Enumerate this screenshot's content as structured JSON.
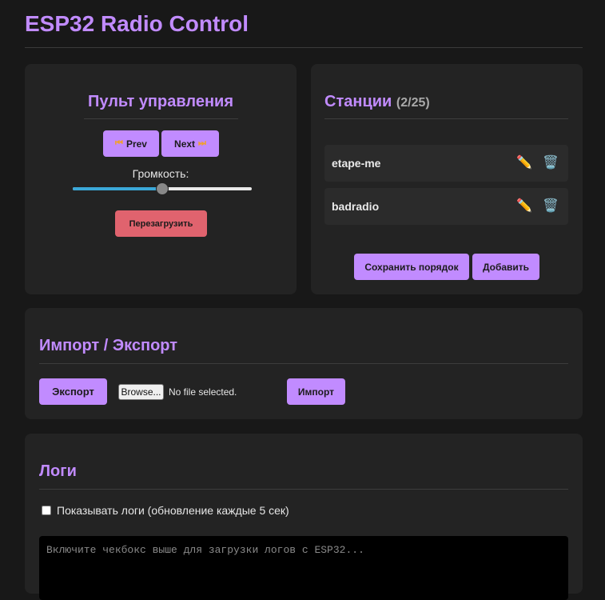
{
  "app": {
    "title": "ESP32 Radio Control"
  },
  "control": {
    "heading": "Пульт управления",
    "prev_label": "Prev",
    "prev_icon": "⏮",
    "next_label": "Next",
    "next_icon": "⏭",
    "volume_label": "Громкость:",
    "volume_level": 0.5,
    "reboot_label": "Перезагрузить"
  },
  "stations": {
    "heading": "Станции",
    "count": "(2/25)",
    "items": [
      {
        "name": "etape-me"
      },
      {
        "name": "badradio"
      }
    ],
    "edit_icon": "✏️",
    "delete_icon": "🗑️",
    "save_order_label": "Сохранить порядок",
    "add_label": "Добавить"
  },
  "import_export": {
    "heading": "Импорт / Экспорт",
    "export_label": "Экспорт",
    "browse_label": "Browse...",
    "file_status": "No file selected.",
    "import_label": "Импорт"
  },
  "logs": {
    "heading": "Логи",
    "checkbox_label": "Показывать логи (обновление каждые 5 сек)",
    "checkbox_checked": false,
    "placeholder": "Включите чекбокс выше для загрузки логов с ESP32..."
  },
  "colors": {
    "accent": "#c18bff",
    "danger": "#e0636e",
    "background": "#181818",
    "card": "#232323",
    "slider_fill": "#3ba8d8"
  }
}
